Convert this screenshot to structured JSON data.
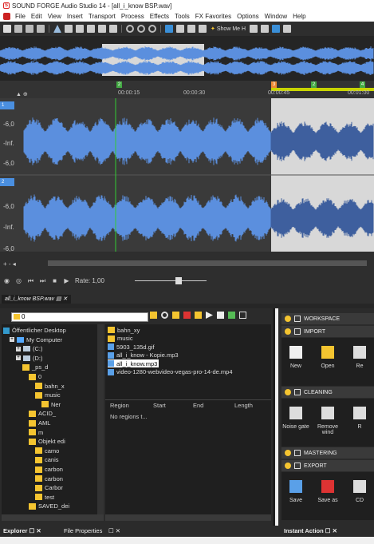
{
  "window": {
    "title": "SOUND FORGE Audio Studio 14 - [all_i_know BSP.wav]"
  },
  "menu": [
    "File",
    "Edit",
    "View",
    "Insert",
    "Transport",
    "Process",
    "Effects",
    "Tools",
    "FX Favorites",
    "Options",
    "Window",
    "Help"
  ],
  "toolbar": {
    "show_me": "Show Me H"
  },
  "ruler": {
    "labels": [
      "00:00:15",
      "00:00:30",
      "00:00:45",
      "00:01:00"
    ],
    "markers": [
      "2",
      "3",
      "2",
      "4"
    ]
  },
  "editor": {
    "db_labels": [
      "-6,0",
      "-Inf.",
      "-6,0",
      "-6,0",
      "-Inf.",
      "-6,0"
    ],
    "channels": [
      "1",
      "2"
    ]
  },
  "transport": {
    "rate_label": "Rate: 1,00"
  },
  "file_tab": {
    "label": "all_i_know BSP.wav"
  },
  "explorer": {
    "path": "0",
    "tree": [
      {
        "label": "Öffentlicher Desktop",
        "type": "desk",
        "indent": 0
      },
      {
        "label": "My Computer",
        "type": "pc",
        "indent": 1
      },
      {
        "label": "(C:)",
        "type": "drive",
        "indent": 2
      },
      {
        "label": "(D:)",
        "type": "drive",
        "indent": 2
      },
      {
        "label": "_ps_d",
        "type": "fold",
        "indent": 3
      },
      {
        "label": "0",
        "type": "fold",
        "indent": 4
      },
      {
        "label": "bahn_x",
        "type": "fold",
        "indent": 5
      },
      {
        "label": "music",
        "type": "fold",
        "indent": 5
      },
      {
        "label": "Ner",
        "type": "fold",
        "indent": 6
      },
      {
        "label": "ACID_",
        "type": "fold",
        "indent": 4
      },
      {
        "label": "AML",
        "type": "fold",
        "indent": 4
      },
      {
        "label": "m",
        "type": "fold",
        "indent": 4
      },
      {
        "label": "Objekt edi",
        "type": "fold",
        "indent": 4
      },
      {
        "label": "camo",
        "type": "fold",
        "indent": 5
      },
      {
        "label": "canis",
        "type": "fold",
        "indent": 5
      },
      {
        "label": "carbon",
        "type": "fold",
        "indent": 5
      },
      {
        "label": "carbon",
        "type": "fold",
        "indent": 5
      },
      {
        "label": "Carbor",
        "type": "fold",
        "indent": 5
      },
      {
        "label": "test",
        "type": "fold",
        "indent": 5
      },
      {
        "label": "SAVED_dei",
        "type": "fold",
        "indent": 4
      }
    ],
    "files": [
      {
        "label": "bahn_xy",
        "type": "fold"
      },
      {
        "label": "music",
        "type": "fold"
      },
      {
        "label": "5903_135d.gif",
        "type": "aud"
      },
      {
        "label": "all_i_know - Kopie.mp3",
        "type": "aud"
      },
      {
        "label": "all_i_know.mp3",
        "type": "aud",
        "selected": true
      },
      {
        "label": "video-1280-webvideo-vegas-pro-14-de.mp4",
        "type": "aud"
      }
    ],
    "region_headers": [
      "Region",
      "Start",
      "End",
      "Length"
    ],
    "no_regions": "No regions t..."
  },
  "bottom_tabs": {
    "explorer": "Explorer ☐ ✕",
    "file_props": "File Properties",
    "close": "☐ ✕",
    "instant": "Instant Action ☐ ✕"
  },
  "instant_action": {
    "sections": [
      {
        "label": "WORKSPACE"
      },
      {
        "label": "IMPORT",
        "buttons": [
          "New",
          "Open",
          "Re"
        ]
      },
      {
        "label": "CLEANING",
        "buttons": [
          "Noise gate",
          "Remove wind",
          "R"
        ]
      },
      {
        "label": "MASTERING"
      },
      {
        "label": "EXPORT",
        "buttons": [
          "Save",
          "Save as",
          "CD"
        ]
      }
    ]
  },
  "colors": {
    "wave": "#5b8fde",
    "selection": "#d8d8d8",
    "accent": "#f4c430"
  }
}
